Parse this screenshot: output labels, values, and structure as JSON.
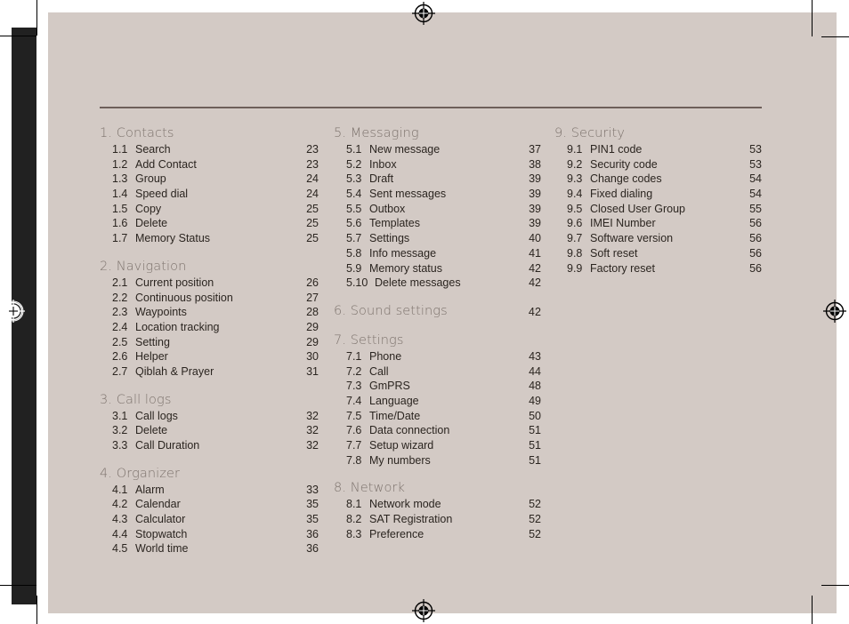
{
  "document": {
    "type": "table-of-contents",
    "accent_rule_color": "#6d5f5a",
    "page_color": "#d3cac5",
    "heading_color": "#7d736d",
    "body_color": "#2b2520",
    "spine_color": "#212121"
  },
  "marks": {
    "registration_icon": "registration-target-icon",
    "crop_mark": "crop-mark"
  },
  "columns": [
    {
      "id": "column-1",
      "sections": [
        {
          "heading": "1. Contacts",
          "page": "",
          "entries": [
            {
              "num": "1.1",
              "label": "Search",
              "page": "23"
            },
            {
              "num": "1.2",
              "label": "Add Contact",
              "page": "23"
            },
            {
              "num": "1.3",
              "label": "Group",
              "page": "24"
            },
            {
              "num": "1.4",
              "label": "Speed dial",
              "page": "24"
            },
            {
              "num": "1.5",
              "label": "Copy",
              "page": "25"
            },
            {
              "num": "1.6",
              "label": "Delete",
              "page": "25"
            },
            {
              "num": "1.7",
              "label": "Memory Status",
              "page": "25"
            }
          ]
        },
        {
          "heading": "2. Navigation",
          "page": "",
          "entries": [
            {
              "num": "2.1",
              "label": "Current position",
              "page": "26"
            },
            {
              "num": "2.2",
              "label": "Continuous position",
              "page": "27"
            },
            {
              "num": "2.3",
              "label": "Waypoints",
              "page": "28"
            },
            {
              "num": "2.4",
              "label": "Location tracking",
              "page": "29"
            },
            {
              "num": "2.5",
              "label": "Setting",
              "page": "29"
            },
            {
              "num": "2.6",
              "label": "Helper",
              "page": "30"
            },
            {
              "num": "2.7",
              "label": "Qiblah & Prayer",
              "page": "31"
            }
          ]
        },
        {
          "heading": "3. Call logs",
          "page": "",
          "entries": [
            {
              "num": "3.1",
              "label": "Call logs",
              "page": "32"
            },
            {
              "num": "3.2",
              "label": "Delete",
              "page": "32"
            },
            {
              "num": "3.3",
              "label": "Call Duration",
              "page": "32"
            }
          ]
        },
        {
          "heading": "4. Organizer",
          "page": "",
          "entries": [
            {
              "num": "4.1",
              "label": "Alarm",
              "page": "33"
            },
            {
              "num": "4.2",
              "label": "Calendar",
              "page": "35"
            },
            {
              "num": "4.3",
              "label": "Calculator",
              "page": "35"
            },
            {
              "num": "4.4",
              "label": "Stopwatch",
              "page": "36"
            },
            {
              "num": "4.5",
              "label": "World time",
              "page": "36"
            }
          ]
        }
      ]
    },
    {
      "id": "column-2",
      "sections": [
        {
          "heading": "5. Messaging",
          "page": "",
          "entries": [
            {
              "num": "5.1",
              "label": "New message",
              "page": "37"
            },
            {
              "num": "5.2",
              "label": "Inbox",
              "page": "38"
            },
            {
              "num": "5.3",
              "label": "Draft",
              "page": "39"
            },
            {
              "num": "5.4",
              "label": "Sent messages",
              "page": "39"
            },
            {
              "num": "5.5",
              "label": "Outbox",
              "page": "39"
            },
            {
              "num": "5.6",
              "label": "Templates",
              "page": "39"
            },
            {
              "num": "5.7",
              "label": "Settings",
              "page": "40"
            },
            {
              "num": "5.8",
              "label": "Info message",
              "page": "41"
            },
            {
              "num": "5.9",
              "label": "Memory status",
              "page": "42"
            },
            {
              "num": "5.10",
              "label": "Delete messages",
              "page": "42"
            }
          ]
        },
        {
          "heading": "6. Sound settings",
          "page": "42",
          "entries": []
        },
        {
          "heading": "7. Settings",
          "page": "",
          "entries": [
            {
              "num": "7.1",
              "label": "Phone",
              "page": "43"
            },
            {
              "num": "7.2",
              "label": "Call",
              "page": "44"
            },
            {
              "num": "7.3",
              "label": "GmPRS",
              "page": "48"
            },
            {
              "num": "7.4",
              "label": "Language",
              "page": "49"
            },
            {
              "num": "7.5",
              "label": "Time/Date",
              "page": "50"
            },
            {
              "num": "7.6",
              "label": "Data connection",
              "page": "51"
            },
            {
              "num": "7.7",
              "label": "Setup wizard",
              "page": "51"
            },
            {
              "num": "7.8",
              "label": "My numbers",
              "page": "51"
            }
          ]
        },
        {
          "heading": "8. Network",
          "page": "",
          "entries": [
            {
              "num": "8.1",
              "label": "Network mode",
              "page": "52"
            },
            {
              "num": "8.2",
              "label": "SAT Registration",
              "page": "52"
            },
            {
              "num": "8.3",
              "label": "Preference",
              "page": "52"
            }
          ]
        }
      ]
    },
    {
      "id": "column-3",
      "sections": [
        {
          "heading": "9. Security",
          "page": "",
          "entries": [
            {
              "num": "9.1",
              "label": "PIN1 code",
              "page": "53"
            },
            {
              "num": "9.2",
              "label": "Security code",
              "page": "53"
            },
            {
              "num": "9.3",
              "label": "Change codes",
              "page": "54"
            },
            {
              "num": "9.4",
              "label": "Fixed dialing",
              "page": "54"
            },
            {
              "num": "9.5",
              "label": "Closed User Group",
              "page": "55"
            },
            {
              "num": "9.6",
              "label": "IMEI Number",
              "page": "56"
            },
            {
              "num": "9.7",
              "label": "Software version",
              "page": "56"
            },
            {
              "num": "9.8",
              "label": "Soft reset",
              "page": "56"
            },
            {
              "num": "9.9",
              "label": "Factory reset",
              "page": "56"
            }
          ]
        }
      ]
    }
  ]
}
